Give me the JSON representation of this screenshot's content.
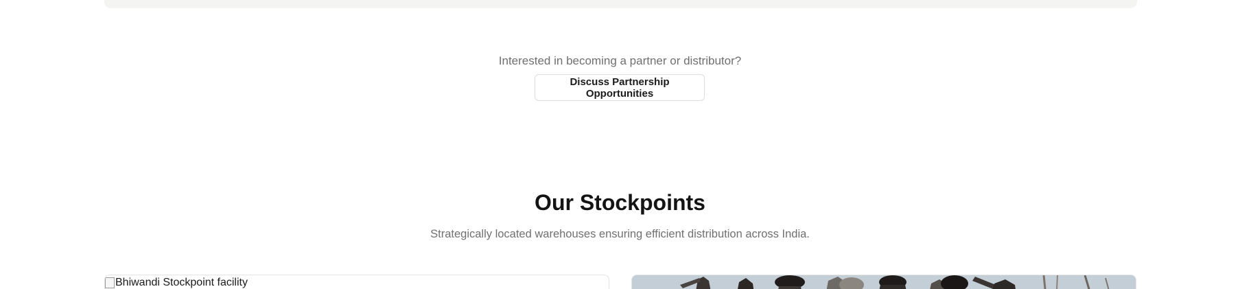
{
  "partnership": {
    "prompt": "Interested in becoming a partner or distributor?",
    "button_label": "Discuss Partnership Opportunities"
  },
  "stockpoints": {
    "title": "Our Stockpoints",
    "subtitle": "Strategically located warehouses ensuring efficient distribution across India.",
    "cards": [
      {
        "image_alt": "Bhiwandi Stockpoint facility"
      },
      {
        "image_alt": ""
      }
    ]
  },
  "colors": {
    "panel_bg": "#f4f4f2",
    "heading": "#141414",
    "muted_text": "#6f6f6f",
    "border": "#dcdcdc"
  }
}
